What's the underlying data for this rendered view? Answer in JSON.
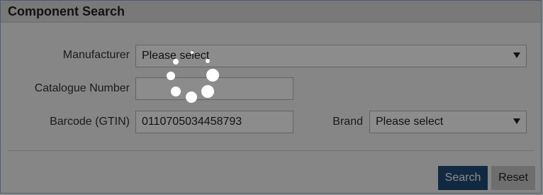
{
  "panel": {
    "title": "Component Search"
  },
  "form": {
    "manufacturer": {
      "label": "Manufacturer",
      "value": "Please select"
    },
    "catalogue_number": {
      "label": "Catalogue Number",
      "value": ""
    },
    "barcode": {
      "label": "Barcode (GTIN)",
      "value": "0110705034458793"
    },
    "brand": {
      "label": "Brand",
      "value": "Please select"
    }
  },
  "actions": {
    "search_label": "Search",
    "reset_label": "Reset"
  },
  "colors": {
    "accent": "#1f4e79",
    "header_bg": "#dcdcdc",
    "overlay": "rgba(0,0,0,0.45)"
  },
  "icons": {
    "loading": "loading-spinner-icon",
    "dropdown": "chevron-down-icon"
  }
}
